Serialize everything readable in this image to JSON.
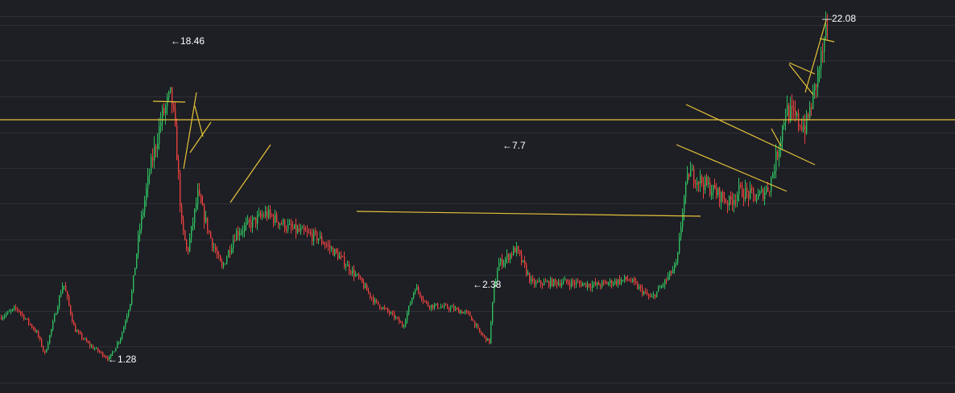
{
  "chart_data": {
    "type": "candlestick",
    "title": "",
    "xlabel": "",
    "ylabel": "",
    "ylim": [
      0,
      23
    ],
    "grid": true,
    "legend": "none",
    "colors": {
      "background": "#1e1f24",
      "grid": "#2e3036",
      "up": "#2ebd5f",
      "down": "#e8413f",
      "trendline": "#e6c23a",
      "label": "#ffffff"
    },
    "price_path": [
      [
        0,
        4.0
      ],
      [
        20,
        4.6
      ],
      [
        45,
        3.0
      ],
      [
        55,
        1.6
      ],
      [
        65,
        3.6
      ],
      [
        78,
        6.3
      ],
      [
        92,
        3.2
      ],
      [
        110,
        2.2
      ],
      [
        135,
        1.28
      ],
      [
        150,
        2.8
      ],
      [
        162,
        5.2
      ],
      [
        172,
        9.5
      ],
      [
        185,
        13.5
      ],
      [
        200,
        17.0
      ],
      [
        212,
        18.46
      ],
      [
        218,
        15.5
      ],
      [
        225,
        10.0
      ],
      [
        232,
        8.2
      ],
      [
        245,
        12.0
      ],
      [
        262,
        9.0
      ],
      [
        275,
        7.2
      ],
      [
        292,
        9.5
      ],
      [
        330,
        10.8
      ],
      [
        360,
        9.8
      ],
      [
        395,
        9.2
      ],
      [
        420,
        8.0
      ],
      [
        445,
        6.5
      ],
      [
        465,
        5.0
      ],
      [
        490,
        4.0
      ],
      [
        500,
        3.4
      ],
      [
        515,
        6.0
      ],
      [
        530,
        4.8
      ],
      [
        560,
        4.6
      ],
      [
        582,
        4.2
      ],
      [
        595,
        3.0
      ],
      [
        607,
        2.38
      ],
      [
        612,
        5.5
      ],
      [
        618,
        7.5
      ],
      [
        625,
        7.7
      ],
      [
        640,
        8.5
      ],
      [
        660,
        6.2
      ],
      [
        700,
        6.3
      ],
      [
        740,
        6.1
      ],
      [
        780,
        6.5
      ],
      [
        808,
        5.2
      ],
      [
        825,
        6.3
      ],
      [
        840,
        7.5
      ],
      [
        848,
        11.5
      ],
      [
        855,
        13.5
      ],
      [
        880,
        12.5
      ],
      [
        905,
        11.5
      ],
      [
        918,
        12.3
      ],
      [
        940,
        11.8
      ],
      [
        955,
        12.6
      ],
      [
        965,
        14.8
      ],
      [
        975,
        17.5
      ],
      [
        985,
        17.0
      ],
      [
        1000,
        16.4
      ],
      [
        1010,
        18.5
      ],
      [
        1018,
        20.5
      ],
      [
        1025,
        22.08
      ]
    ],
    "annotations": [
      {
        "label": "←18.46",
        "value": 18.46
      },
      {
        "label": "←1.28",
        "value": 1.28
      },
      {
        "label": "←7.7",
        "value": 7.7
      },
      {
        "label": "←2.38",
        "value": 2.38
      },
      {
        "label": "—22.08",
        "value": 22.08
      }
    ],
    "horizontal_line": 14.8
  }
}
